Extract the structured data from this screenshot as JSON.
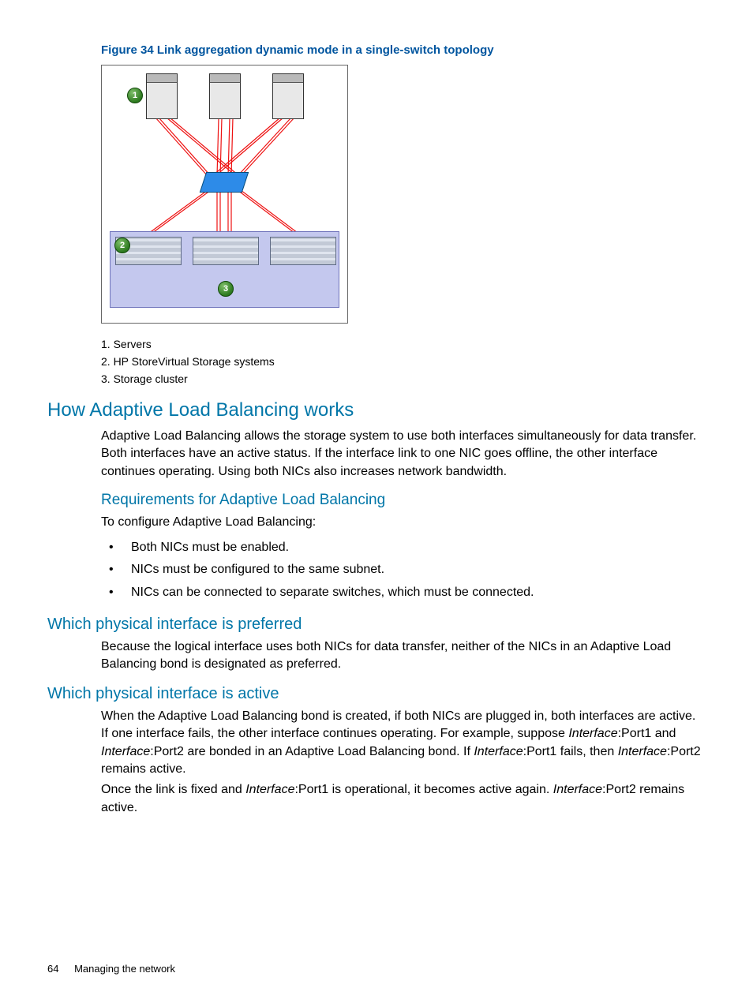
{
  "figure": {
    "caption": "Figure 34 Link aggregation dynamic mode in a single-switch topology",
    "badges": {
      "b1": "1",
      "b2": "2",
      "b3": "3"
    }
  },
  "legend": {
    "l1": "1. Servers",
    "l2": "2. HP StoreVirtual Storage systems",
    "l3": "3. Storage cluster"
  },
  "sections": {
    "h1": "How Adaptive Load Balancing works",
    "p1": "Adaptive Load Balancing allows the storage system to use both interfaces simultaneously for data transfer. Both interfaces have an active status. If the interface link to one NIC goes offline, the other interface continues operating. Using both NICs also increases network bandwidth.",
    "h2": "Requirements for Adaptive Load Balancing",
    "p2": "To configure Adaptive Load Balancing:",
    "bullets": {
      "b1": "Both NICs must be enabled.",
      "b2": "NICs must be configured to the same subnet.",
      "b3": "NICs can be connected to separate switches, which must be connected."
    },
    "h3": "Which physical interface is preferred",
    "p3": "Because the logical interface uses both NICs for data transfer, neither of the NICs in an Adaptive Load Balancing bond is designated as preferred.",
    "h4": "Which physical interface is active",
    "p4a": "When the Adaptive Load Balancing bond is created, if both NICs are plugged in, both interfaces are active. If one interface fails, the other interface continues operating. For example, suppose ",
    "p4b": ":Port1 and ",
    "p4c": ":Port2 are bonded in an Adaptive Load Balancing bond. If ",
    "p4d": ":Port1 fails, then ",
    "p4e": ":Port2 remains active.",
    "p5a": "Once the link is fixed and ",
    "p5b": ":Port1 is operational, it becomes active again. ",
    "p5c": ":Port2 remains active.",
    "iface": "Interface"
  },
  "footer": {
    "page": "64",
    "title": "Managing the network"
  }
}
